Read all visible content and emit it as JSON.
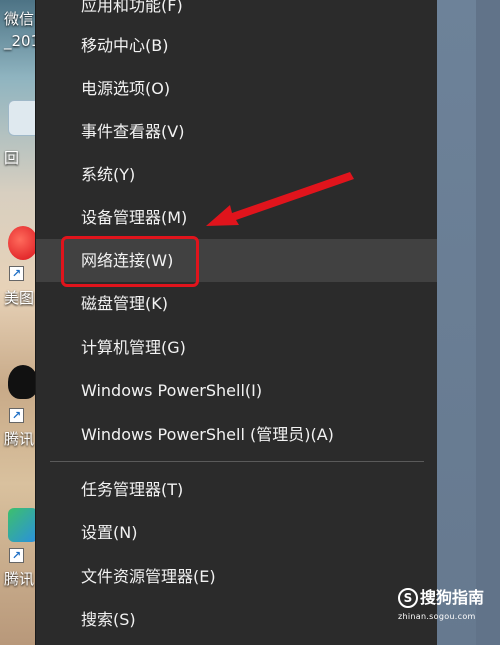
{
  "desktop": {
    "labels": [
      "微信",
      "_201",
      "回",
      "美图",
      "腾讯",
      "腾讯"
    ]
  },
  "menu": {
    "items": [
      {
        "label": "应用和功能(F)"
      },
      {
        "label": "移动中心(B)"
      },
      {
        "label": "电源选项(O)"
      },
      {
        "label": "事件查看器(V)"
      },
      {
        "label": "系统(Y)"
      },
      {
        "label": "设备管理器(M)"
      },
      {
        "label": "网络连接(W)"
      },
      {
        "label": "磁盘管理(K)"
      },
      {
        "label": "计算机管理(G)"
      },
      {
        "label": "Windows PowerShell(I)"
      },
      {
        "label": "Windows PowerShell (管理员)(A)"
      },
      {
        "label": "任务管理器(T)"
      },
      {
        "label": "设置(N)"
      },
      {
        "label": "文件资源管理器(E)"
      },
      {
        "label": "搜索(S)"
      }
    ],
    "highlighted_item": "网络连接(W)"
  },
  "annotation": {
    "highlight_color": "#e0141c",
    "arrow_color": "#e0141c"
  },
  "watermark": {
    "logo": "S",
    "name": "搜狗指南",
    "url": "zhinan.sogou.com"
  }
}
